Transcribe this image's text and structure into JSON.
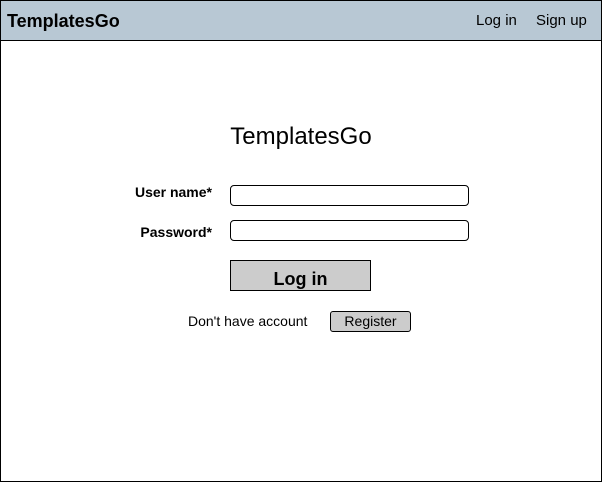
{
  "header": {
    "brand": "TemplatesGo",
    "nav": {
      "login": "Log in",
      "signup": "Sign up"
    },
    "background_color": "#b8c8d4"
  },
  "main": {
    "title": "TemplatesGo",
    "form": {
      "username_label": "User name*",
      "username_value": "",
      "password_label": "Password*",
      "password_value": "",
      "submit_label": "Log in"
    },
    "register": {
      "prompt": "Don't have account",
      "button_label": "Register"
    }
  },
  "colors": {
    "button_fill": "#cccccc",
    "border": "#000000"
  }
}
